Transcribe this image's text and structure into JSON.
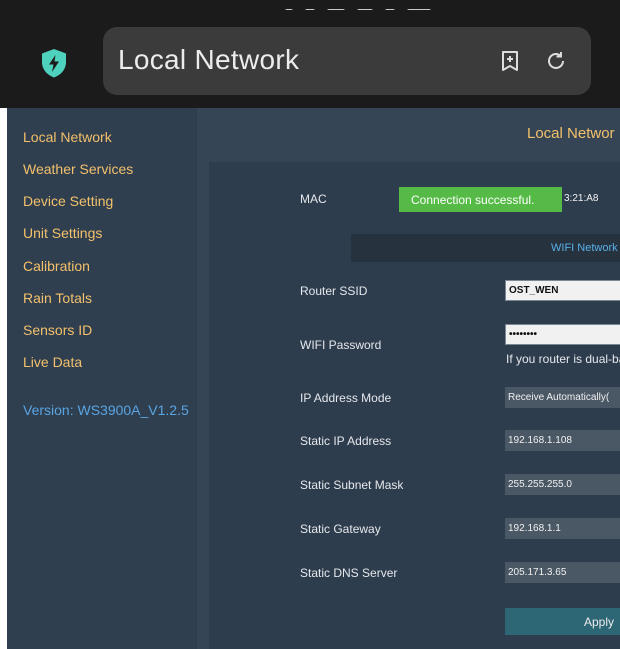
{
  "browser": {
    "title": "Local Network",
    "icons": {
      "app": "shield-bolt-icon",
      "add_tab": "add-tab-icon",
      "reload": "reload-icon"
    }
  },
  "sidebar": {
    "items": [
      {
        "label": "Local Network"
      },
      {
        "label": "Weather Services"
      },
      {
        "label": "Device Setting"
      },
      {
        "label": "Unit Settings"
      },
      {
        "label": "Calibration"
      },
      {
        "label": "Rain Totals"
      },
      {
        "label": "Sensors ID"
      },
      {
        "label": "Live Data"
      }
    ],
    "version": "Version: WS3900A_V1.2.5"
  },
  "main": {
    "title": "Local Networ",
    "toast": "Connection successful.",
    "mac": {
      "label": "MAC",
      "value": "3:21:A8"
    },
    "wifi_tab": "WIFI Network",
    "router_ssid": {
      "label": "Router SSID",
      "value": "OST_WEN"
    },
    "wifi_password": {
      "label": "WIFI Password",
      "value": "••••••••",
      "hint": "If you router is dual-ba"
    },
    "ip_mode": {
      "label": "IP Address Mode",
      "value": "Receive Automatically("
    },
    "static_ip": {
      "label": "Static IP Address",
      "value": "192.168.1.108"
    },
    "subnet": {
      "label": "Static Subnet Mask",
      "value": "255.255.255.0"
    },
    "gateway": {
      "label": "Static Gateway",
      "value": "192.168.1.1"
    },
    "dns": {
      "label": "Static DNS Server",
      "value": "205.171.3.65"
    },
    "apply_label": "Apply"
  },
  "colors": {
    "sidebar_bg": "#2f3f4f",
    "main_bg": "#354556",
    "panel_bg": "#2e3d4d",
    "nav_text": "#f3c06b",
    "version_text": "#59a4e3",
    "toast_bg": "#56ba47",
    "apply_bg": "#2d6675"
  }
}
